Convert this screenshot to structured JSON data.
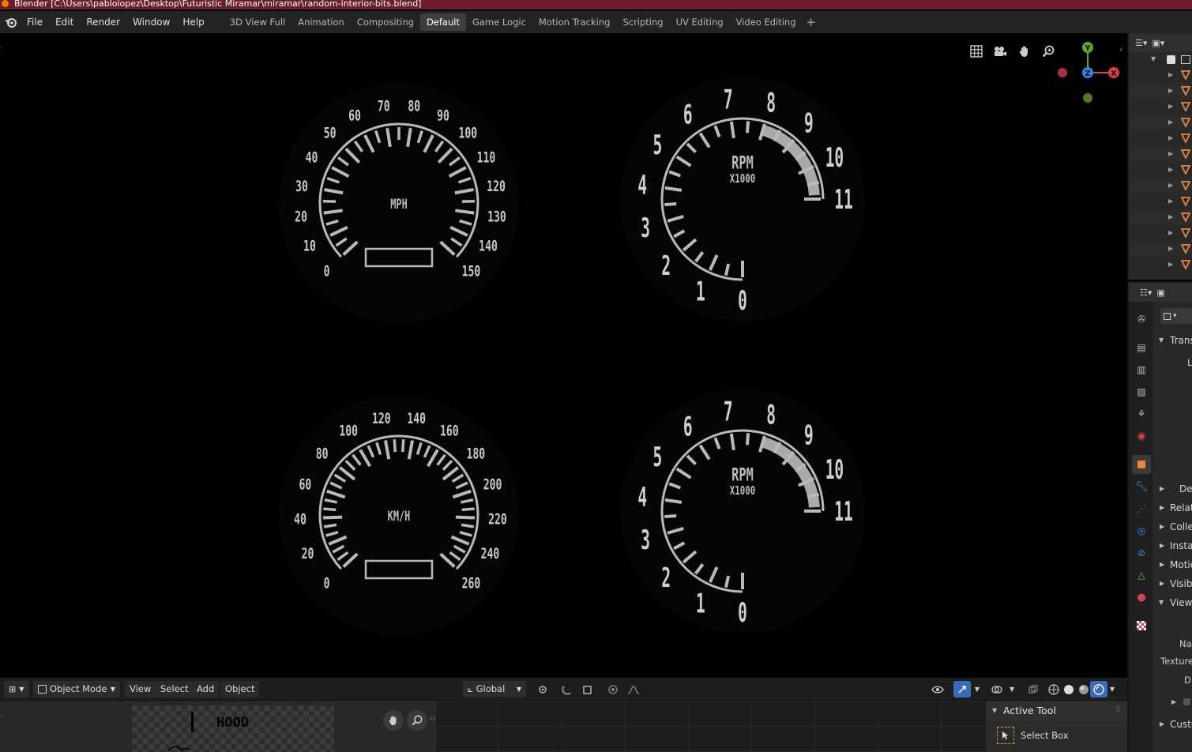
{
  "window": {
    "title": "Blender [C:\\Users\\pablolopez\\Desktop\\Futuristic Miramar\\miramar\\random-interior-bits.blend]"
  },
  "menu": {
    "items": [
      "File",
      "Edit",
      "Render",
      "Window",
      "Help"
    ]
  },
  "workspace_tabs": {
    "items": [
      "3D View Full",
      "Animation",
      "Compositing",
      "Default",
      "Game Logic",
      "Motion Tracking",
      "Scripting",
      "UV Editing",
      "Video Editing"
    ],
    "active": "Default",
    "add_label": "+"
  },
  "gauges": {
    "speedo_mph": {
      "unit": "MPH",
      "min": 0,
      "max": 150,
      "label_step": 10,
      "minor_per_label": 2,
      "labels": [
        "0",
        "10",
        "20",
        "30",
        "40",
        "50",
        "60",
        "70",
        "80",
        "90",
        "100",
        "110",
        "120",
        "130",
        "140",
        "150"
      ]
    },
    "speedo_kmh": {
      "unit": "KM/H",
      "min": 0,
      "max": 260,
      "label_step": 20,
      "minor_per_label": 3,
      "labels": [
        "0",
        "20",
        "40",
        "60",
        "80",
        "100",
        "120",
        "140",
        "160",
        "180",
        "200",
        "220",
        "240",
        "260"
      ]
    },
    "tacho_top": {
      "unit": "RPM",
      "sub": "X1000",
      "min": 0,
      "max": 11,
      "redline_from": 8,
      "labels": [
        "0",
        "1",
        "2",
        "3",
        "4",
        "5",
        "6",
        "7",
        "8",
        "9",
        "10",
        "11"
      ]
    },
    "tacho_bottom": {
      "unit": "RPM",
      "sub": "X1000",
      "min": 0,
      "max": 11,
      "redline_from": 8,
      "labels": [
        "0",
        "1",
        "2",
        "3",
        "4",
        "5",
        "6",
        "7",
        "8",
        "9",
        "10",
        "11"
      ]
    }
  },
  "viewport_header": {
    "mode": "Object Mode",
    "menus": [
      "View",
      "Select",
      "Add",
      "Object"
    ],
    "orientation": "Global"
  },
  "navigation_gizmo": {
    "y_label": "Y",
    "z_label": "Z",
    "x_label": "X",
    "colors": {
      "x": "#e23c4f",
      "y": "#6ba12d",
      "z": "#2f85e4"
    }
  },
  "image_editor": {
    "image_text": "HOOD"
  },
  "active_tool": {
    "title": "Active Tool",
    "tool_name": "Select Box"
  },
  "properties": {
    "sections": [
      "Trans",
      "L",
      "De",
      "Relat",
      "Colle",
      "Insta",
      "Motio",
      "Visibi",
      "View",
      "Na",
      "Texture",
      "D",
      "Custo"
    ]
  },
  "colors": {
    "titlebar": "#6b1d2b",
    "accent_blue": "#3a6bb8",
    "mesh_orange": "#e8873a"
  }
}
